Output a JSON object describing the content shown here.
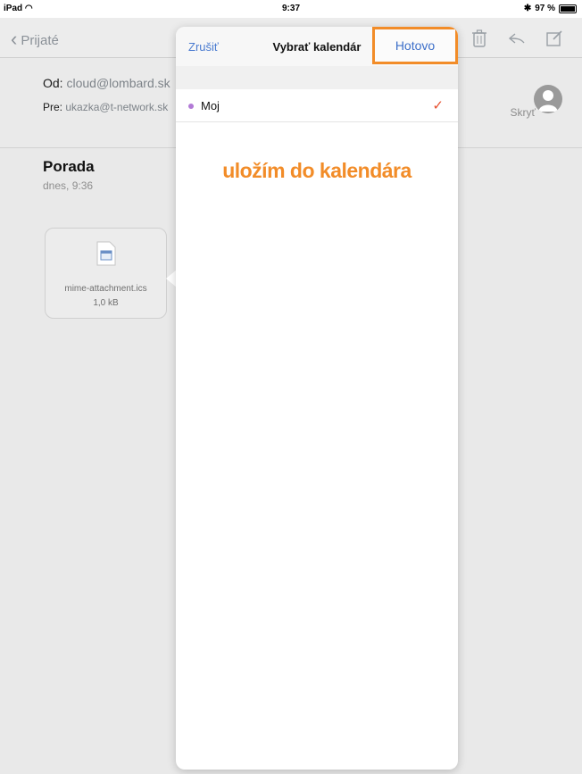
{
  "statusbar": {
    "device": "iPad",
    "time": "9:37",
    "battery": "97 %"
  },
  "nav": {
    "back_label": "Prijaté",
    "icons": [
      "trash-icon",
      "reply-icon",
      "compose-icon"
    ]
  },
  "mail": {
    "from_label": "Od:",
    "from_value": "cloud@lombard.sk",
    "to_label": "Pre:",
    "to_value": "ukazka@t-network.sk",
    "hide_label": "Skryť",
    "subject": "Porada",
    "date": "dnes, 9:36"
  },
  "attachment": {
    "file_name": "mime-attachment.ics",
    "file_size": "1,0 kB"
  },
  "popover": {
    "cancel_label": "Zrušiť",
    "title": "Vybrať kalendár",
    "done_label": "Hotovo",
    "calendars": [
      {
        "name": "Moj",
        "selected": true,
        "color": "#b27ad6"
      }
    ],
    "annotation": "uložím do kalendára"
  },
  "colors": {
    "accent": "#f28c28",
    "link": "#4a7bd0",
    "check": "#e6502f"
  }
}
